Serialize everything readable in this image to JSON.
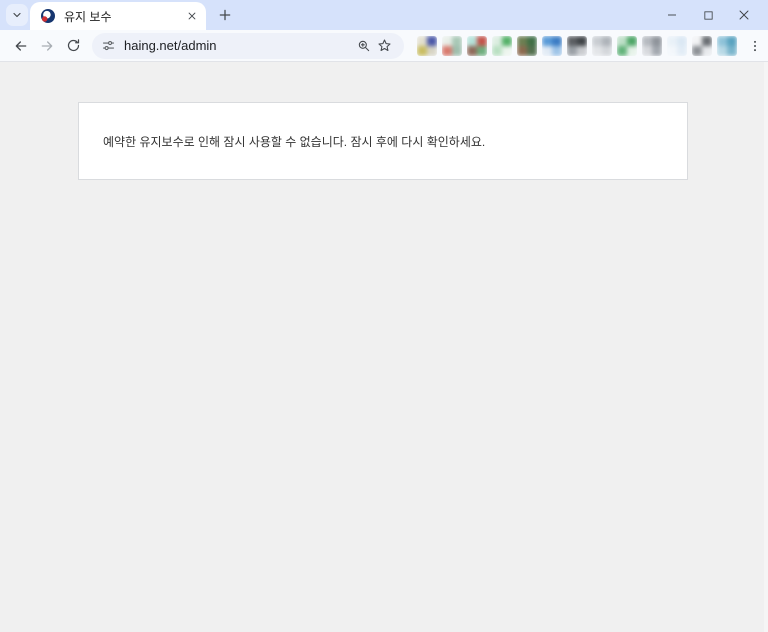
{
  "browser": {
    "tab_title": "유지 보수",
    "url": "haing.net/admin",
    "theme": {
      "tabstrip_bg": "#d6e2fb",
      "toolbar_bg": "#f8fafd",
      "omnibox_bg": "#eef1f9",
      "icon_color": "#45494e",
      "disabled_icon_color": "#a9aeb4"
    },
    "favicon_colors": {
      "navy": "#16366f",
      "red": "#cf2f34",
      "white": "#ffffff"
    },
    "extensions": [
      {
        "name": "extension-icon-1",
        "colors": [
          "#e3e0d0",
          "#4a57a8",
          "#c9bd62",
          "#d8d5c6"
        ]
      },
      {
        "name": "extension-icon-2",
        "colors": [
          "#e9efe9",
          "#a9c8b6",
          "#d97a6e",
          "#9fbfae"
        ]
      },
      {
        "name": "extension-icon-3",
        "colors": [
          "#b5e3da",
          "#c3524a",
          "#8f6a5a",
          "#6fae7f"
        ]
      },
      {
        "name": "extension-icon-4",
        "colors": [
          "#ddeee2",
          "#54b168",
          "#b9e0c2",
          "#edf5ee"
        ]
      },
      {
        "name": "extension-icon-5",
        "colors": [
          "#6d7f52",
          "#3f6f46",
          "#8c6a4f",
          "#52704f"
        ]
      },
      {
        "name": "extension-icon-6",
        "colors": [
          "#5a9bd8",
          "#3b7cc4",
          "#e2ebf5",
          "#9ec4e8"
        ]
      },
      {
        "name": "extension-icon-7",
        "colors": [
          "#5c5f63",
          "#3f4347",
          "#9aa0a6",
          "#caccd0"
        ]
      },
      {
        "name": "extension-icon-8",
        "colors": [
          "#c9cdd2",
          "#aeb3b9",
          "#e3e5e8",
          "#d4d7db"
        ]
      },
      {
        "name": "extension-icon-9",
        "colors": [
          "#bfe0c8",
          "#4da667",
          "#62b37a",
          "#e6f2e9"
        ]
      },
      {
        "name": "extension-icon-10",
        "colors": [
          "#b6bac0",
          "#8f949b",
          "#d8dade",
          "#a3a8af"
        ]
      },
      {
        "name": "extension-icon-11",
        "colors": [
          "#e9f1f8",
          "#dbe8f4",
          "#f3f7fb",
          "#e2ecf6"
        ]
      },
      {
        "name": "extension-icon-12",
        "colors": [
          "#f2f3f5",
          "#6a6e73",
          "#8d9196",
          "#e8eaed"
        ]
      },
      {
        "name": "extension-icon-13",
        "colors": [
          "#8fc3d9",
          "#5aa3c0",
          "#b8d9e6",
          "#7ab5cc"
        ]
      }
    ]
  },
  "page": {
    "message": "예약한 유지보수로 인해 잠시 사용할 수 없습니다. 잠시 후에 다시 확인하세요.",
    "background": "#f0f0f0",
    "box_bg": "#ffffff",
    "box_border": "#d9dbde",
    "text_color": "#333333"
  }
}
